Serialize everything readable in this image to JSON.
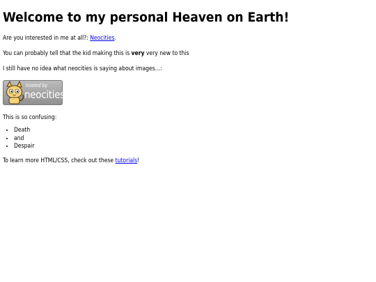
{
  "heading": "Welcome to my personal Heaven on Earth!",
  "intro": {
    "prefix": "Are you interested in me at all?: ",
    "link_label": "Neocities",
    "suffix": "."
  },
  "kid_line": {
    "prefix": "You can probably tell that the kid making this is ",
    "bold": "very",
    "suffix": " very new to this"
  },
  "images_line": "I still have no idea what neocities is saying about images...:",
  "badge": {
    "hosted_text": "hosted by",
    "brand_text": "neocities"
  },
  "confusing_line": "This is so confusing:",
  "list_items": [
    "Death",
    "and",
    "Despair"
  ],
  "learn_line": {
    "prefix": "To learn more HTML/CSS, check out these ",
    "link_label": "tutorials",
    "suffix": "!"
  },
  "colors": {
    "link": "#0000ee",
    "text": "#000000",
    "background": "#ffffff"
  },
  "icons": [
    "neocities-cat-icon"
  ]
}
